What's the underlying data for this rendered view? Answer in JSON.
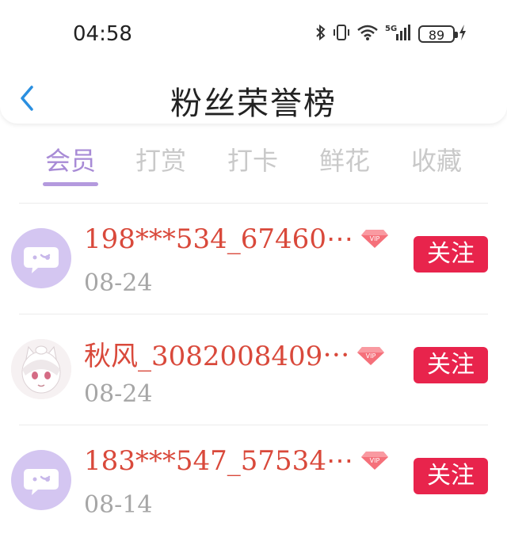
{
  "status_bar": {
    "time": "04:58",
    "battery": "89",
    "network": "5G"
  },
  "header": {
    "title": "粉丝荣誉榜"
  },
  "tabs": [
    {
      "label": "会员",
      "active": true
    },
    {
      "label": "打赏",
      "active": false
    },
    {
      "label": "打卡",
      "active": false
    },
    {
      "label": "鲜花",
      "active": false
    },
    {
      "label": "收藏",
      "active": false
    }
  ],
  "fans": [
    {
      "name": "198***534_67460⋯",
      "date": "08-24",
      "avatar": "chat-bubble-avatar",
      "badge": "VIP",
      "action": "关注"
    },
    {
      "name": "秋风_3082008409⋯",
      "date": "08-24",
      "avatar": "anime-cat-avatar",
      "badge": "VIP",
      "action": "关注"
    },
    {
      "name": "183***547_57534⋯",
      "date": "08-14",
      "avatar": "chat-bubble-avatar",
      "badge": "VIP",
      "action": "关注"
    }
  ],
  "colors": {
    "accent": "#b49ade",
    "name": "#d9493b",
    "follow_bg": "#e8244c",
    "muted": "#a6a6a6"
  }
}
